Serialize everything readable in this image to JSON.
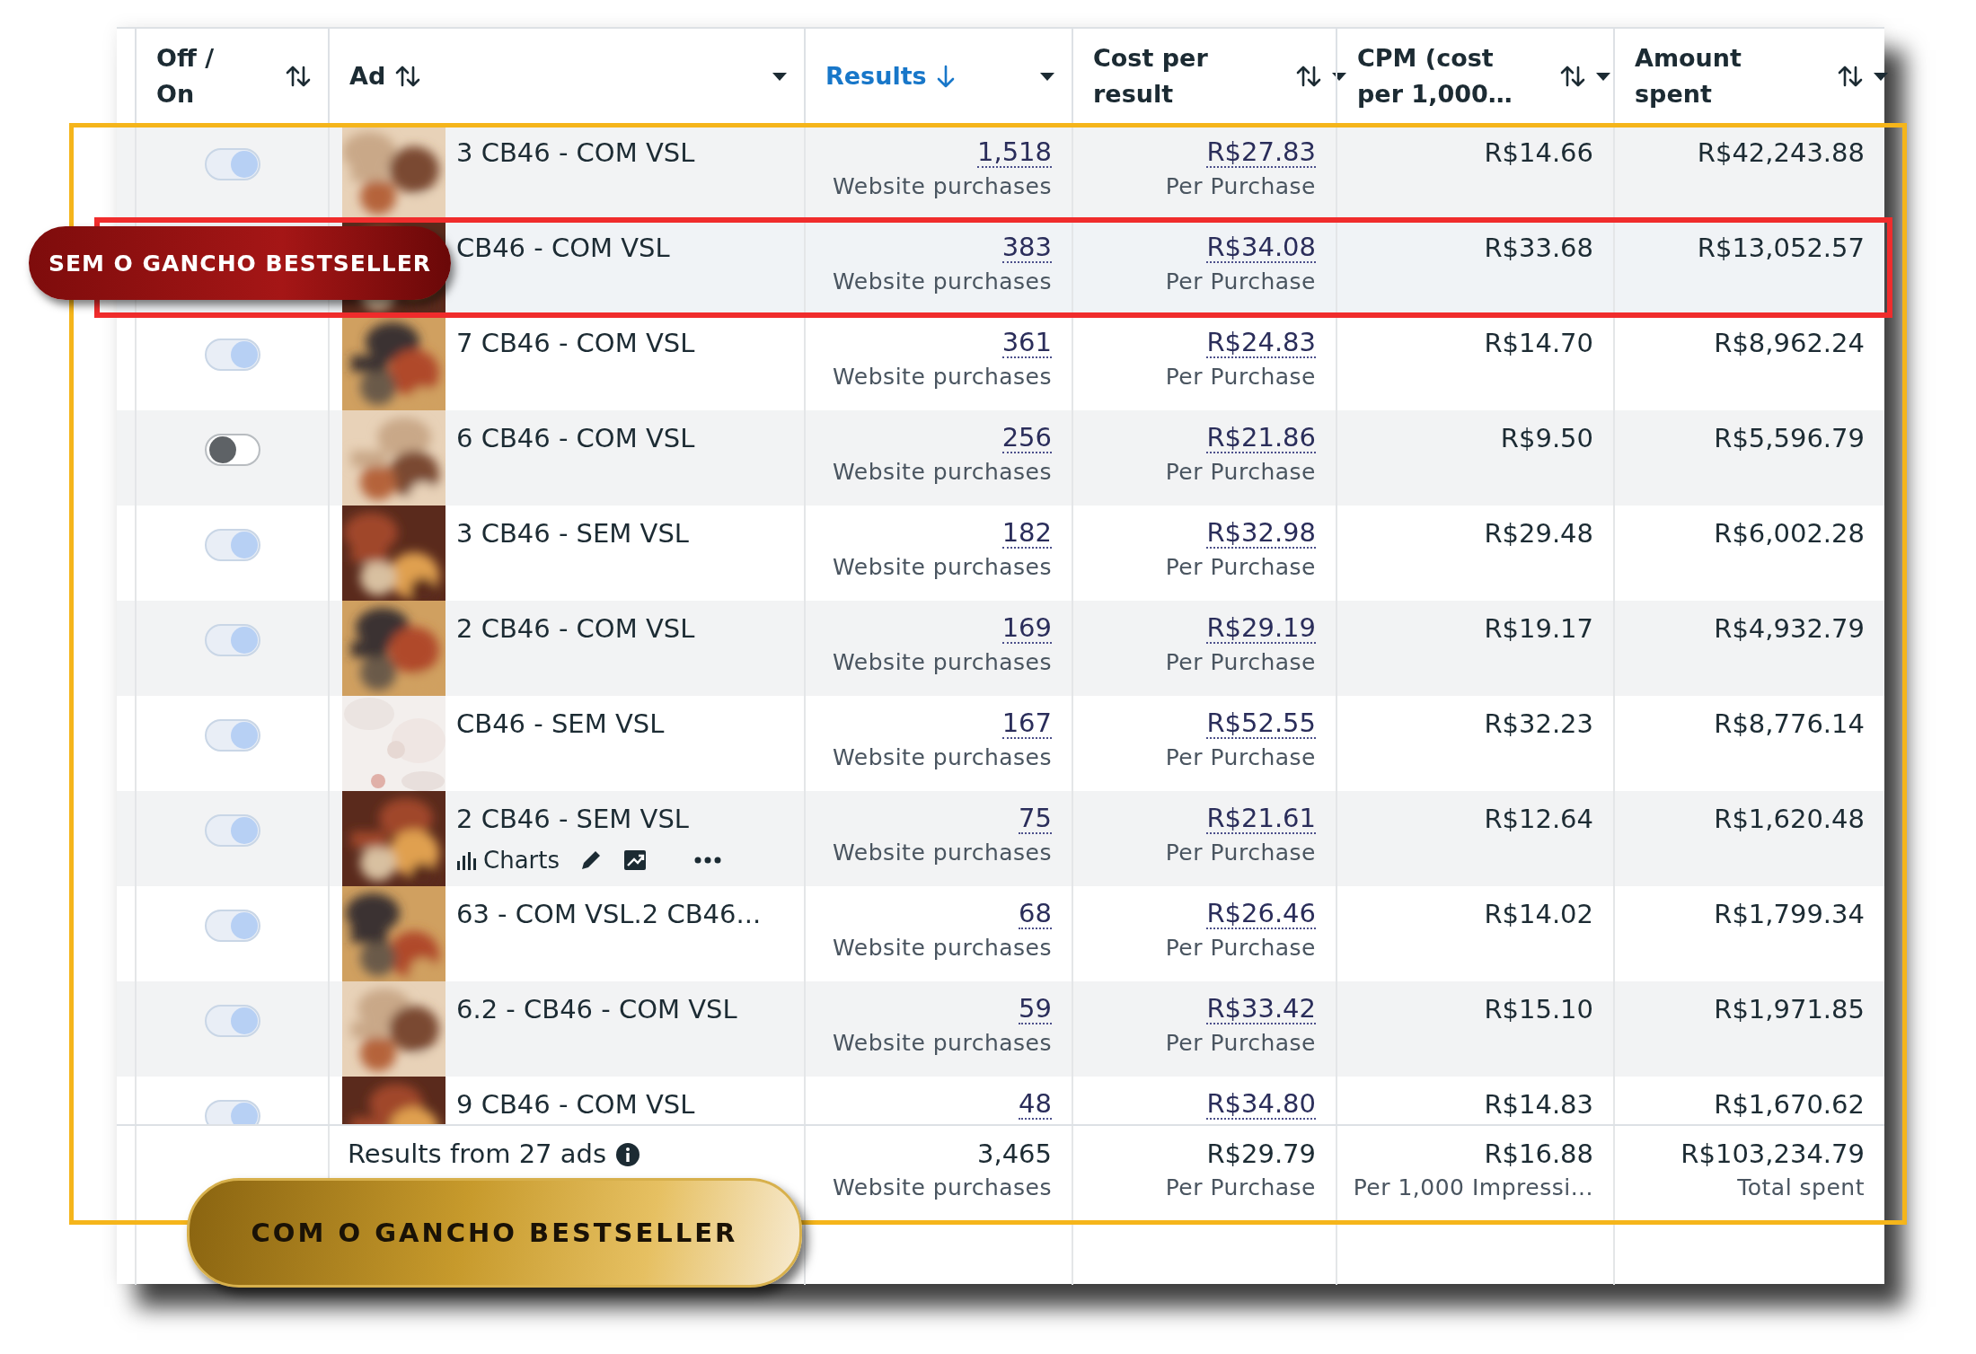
{
  "columns": [
    {
      "label": "Off / On",
      "sortable": true,
      "dropdown": false,
      "sorted": false
    },
    {
      "label": "Ad",
      "sortable": true,
      "dropdown": true,
      "sorted": false
    },
    {
      "label": "Results",
      "sortable": false,
      "dropdown": true,
      "sorted": true
    },
    {
      "label": "Cost per result",
      "sortable": true,
      "dropdown": true,
      "sorted": false
    },
    {
      "label": "CPM (cost per 1,000…",
      "sortable": true,
      "dropdown": true,
      "sorted": false
    },
    {
      "label": "Amount spent",
      "sortable": true,
      "dropdown": true,
      "sorted": false
    }
  ],
  "rows": [
    {
      "on": true,
      "name": "3 CB46 - COM VSL",
      "results": "1,518",
      "results_label": "Website purchases",
      "cost": "R$27.83",
      "cost_label": "Per Purchase",
      "cpm": "R$14.66",
      "amount": "R$42,243.88",
      "highlighted": false
    },
    {
      "name": "CB46 - COM VSL",
      "results": "383",
      "results_label": "Website purchases",
      "cost": "R$34.08",
      "cost_label": "Per Purchase",
      "cpm": "R$33.68",
      "amount": "R$13,052.57",
      "highlighted": true
    },
    {
      "on": true,
      "name": "7 CB46 - COM VSL",
      "results": "361",
      "results_label": "Website purchases",
      "cost": "R$24.83",
      "cost_label": "Per Purchase",
      "cpm": "R$14.70",
      "amount": "R$8,962.24",
      "highlighted": false
    },
    {
      "on": false,
      "name": "6 CB46 - COM VSL",
      "results": "256",
      "results_label": "Website purchases",
      "cost": "R$21.86",
      "cost_label": "Per Purchase",
      "cpm": "R$9.50",
      "amount": "R$5,596.79",
      "highlighted": false
    },
    {
      "on": true,
      "name": "3 CB46 - SEM VSL",
      "results": "182",
      "results_label": "Website purchases",
      "cost": "R$32.98",
      "cost_label": "Per Purchase",
      "cpm": "R$29.48",
      "amount": "R$6,002.28",
      "highlighted": false
    },
    {
      "on": true,
      "name": "2 CB46 - COM VSL",
      "results": "169",
      "results_label": "Website purchases",
      "cost": "R$29.19",
      "cost_label": "Per Purchase",
      "cpm": "R$19.17",
      "amount": "R$4,932.79",
      "highlighted": false
    },
    {
      "on": true,
      "name": "CB46 - SEM VSL",
      "results": "167",
      "results_label": "Website purchases",
      "cost": "R$52.55",
      "cost_label": "Per Purchase",
      "cpm": "R$32.23",
      "amount": "R$8,776.14",
      "highlighted": false
    },
    {
      "on": true,
      "name": "2 CB46 - SEM VSL",
      "actions": {
        "charts": "Charts"
      },
      "results": "75",
      "results_label": "Website purchases",
      "cost": "R$21.61",
      "cost_label": "Per Purchase",
      "cpm": "R$12.64",
      "amount": "R$1,620.48",
      "highlighted": false
    },
    {
      "on": true,
      "name": "63 - COM VSL.2 CB46...",
      "results": "68",
      "results_label": "Website purchases",
      "cost": "R$26.46",
      "cost_label": "Per Purchase",
      "cpm": "R$14.02",
      "amount": "R$1,799.34",
      "highlighted": false
    },
    {
      "on": true,
      "name": "6.2 - CB46 - COM VSL",
      "results": "59",
      "results_label": "Website purchases",
      "cost": "R$33.42",
      "cost_label": "Per Purchase",
      "cpm": "R$15.10",
      "amount": "R$1,971.85",
      "highlighted": false
    },
    {
      "on": true,
      "name": "9 CB46 - COM VSL",
      "results": "48",
      "cost": "R$34.80",
      "cpm": "R$14.83",
      "amount": "R$1,670.62",
      "highlighted": false
    }
  ],
  "footer": {
    "label": "Results from 27 ads",
    "results": "3,465",
    "results_label": "Website purchases",
    "cost": "R$29.79",
    "cost_label": "Per Purchase",
    "cpm": "R$16.88",
    "cpm_label": "Per 1,000 Impressi...",
    "amount": "R$103,234.79",
    "amount_label": "Total spent"
  },
  "callouts": [
    {
      "kind": "red",
      "text": "SEM O GANCHO BESTSELLER"
    },
    {
      "kind": "gold",
      "text": "COM O GANCHO BESTSELLER"
    }
  ]
}
